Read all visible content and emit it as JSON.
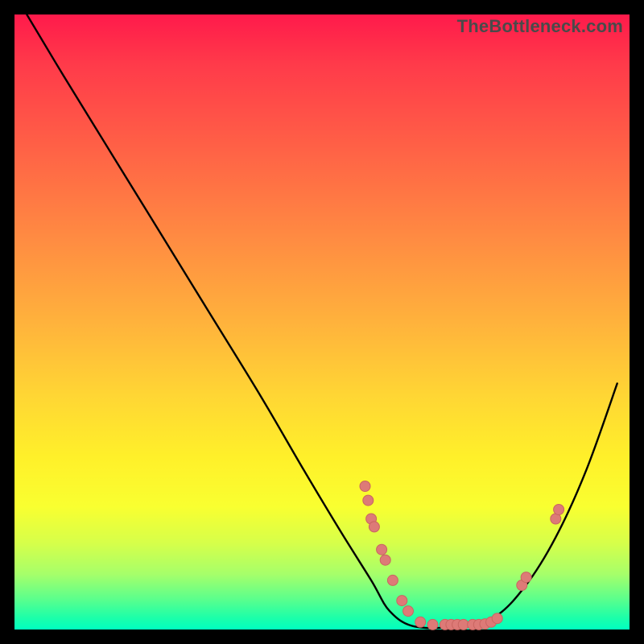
{
  "watermark": "TheBottleneck.com",
  "colors": {
    "frame": "#000000",
    "curve": "#000000",
    "markerFill": "#dd7a77",
    "markerStroke": "#c96561",
    "gradientStops": [
      "#ff1a4b",
      "#ff6246",
      "#ffb23c",
      "#fff02a",
      "#5cff8c",
      "#00ffc0"
    ]
  },
  "chart_data": {
    "type": "line",
    "title": "",
    "xlabel": "",
    "ylabel": "",
    "xlim": [
      0,
      1
    ],
    "ylim": [
      0,
      1
    ],
    "note": "No axis tick labels or units are shown in the image; values are normalized pixel-fractions estimated from the chart geometry.",
    "series": [
      {
        "name": "curve",
        "x": [
          0.02,
          0.08,
          0.16,
          0.24,
          0.32,
          0.4,
          0.47,
          0.53,
          0.58,
          0.61,
          0.65,
          0.72,
          0.78,
          0.83,
          0.88,
          0.93,
          0.98
        ],
        "y": [
          1.0,
          0.9,
          0.77,
          0.64,
          0.51,
          0.38,
          0.26,
          0.16,
          0.08,
          0.03,
          0.005,
          0.005,
          0.02,
          0.07,
          0.15,
          0.26,
          0.4
        ]
      }
    ],
    "markers": [
      {
        "x": 0.57,
        "y": 0.233
      },
      {
        "x": 0.575,
        "y": 0.21
      },
      {
        "x": 0.58,
        "y": 0.18
      },
      {
        "x": 0.585,
        "y": 0.167
      },
      {
        "x": 0.597,
        "y": 0.13
      },
      {
        "x": 0.603,
        "y": 0.113
      },
      {
        "x": 0.615,
        "y": 0.08
      },
      {
        "x": 0.63,
        "y": 0.047
      },
      {
        "x": 0.64,
        "y": 0.03
      },
      {
        "x": 0.66,
        "y": 0.012
      },
      {
        "x": 0.68,
        "y": 0.008
      },
      {
        "x": 0.7,
        "y": 0.008
      },
      {
        "x": 0.71,
        "y": 0.008
      },
      {
        "x": 0.72,
        "y": 0.008
      },
      {
        "x": 0.73,
        "y": 0.008
      },
      {
        "x": 0.745,
        "y": 0.008
      },
      {
        "x": 0.755,
        "y": 0.008
      },
      {
        "x": 0.765,
        "y": 0.009
      },
      {
        "x": 0.775,
        "y": 0.012
      },
      {
        "x": 0.785,
        "y": 0.018
      },
      {
        "x": 0.825,
        "y": 0.072
      },
      {
        "x": 0.832,
        "y": 0.085
      },
      {
        "x": 0.88,
        "y": 0.18
      },
      {
        "x": 0.885,
        "y": 0.195
      }
    ]
  }
}
